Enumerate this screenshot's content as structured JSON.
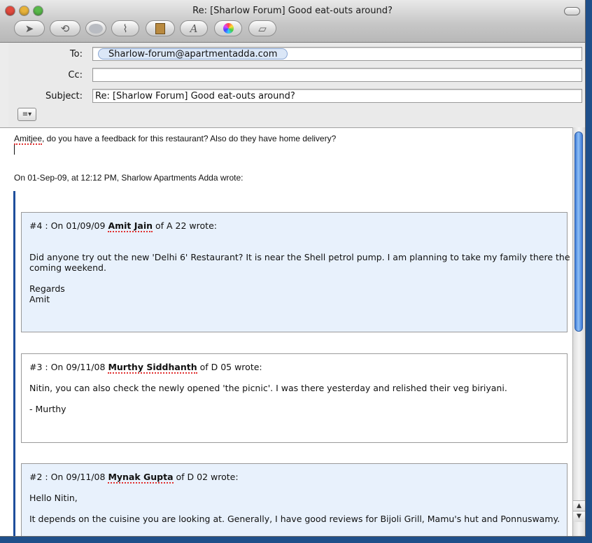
{
  "window": {
    "title": "Re: [Sharlow Forum] Good eat-outs around?",
    "traffic_colors": {
      "close": "#e24a3e",
      "minimize": "#e8b33a",
      "zoom": "#59b94a"
    }
  },
  "toolbar": {
    "buttons": [
      {
        "name": "send-icon",
        "glyph": "➤"
      },
      {
        "name": "reply-all-icon",
        "glyph": "⟲"
      },
      {
        "name": "chat-icon",
        "glyph": ""
      },
      {
        "name": "attach-icon",
        "glyph": "⌇"
      },
      {
        "name": "address-book-icon",
        "glyph": "▤"
      },
      {
        "name": "fonts-icon",
        "glyph": "A"
      },
      {
        "name": "colors-icon",
        "glyph": ""
      },
      {
        "name": "stationery-icon",
        "glyph": "▱"
      }
    ]
  },
  "header": {
    "to_label": "To:",
    "to_value": "Sharlow-forum@apartmentadda.com",
    "cc_label": "Cc:",
    "cc_value": "",
    "subject_label": "Subject:",
    "subject_value": "Re: [Sharlow Forum] Good eat-outs around?",
    "account_glyph": "≡▾"
  },
  "body": {
    "reply_prefix": "Amitjee",
    "reply_rest": ", do you have a feedback for this restaurant? Also do they have home delivery?",
    "attribution": "On 01-Sep-09, at 12:12 PM, Sharlow Apartments Adda wrote:"
  },
  "posts": [
    {
      "num": "#4 : On 01/09/09 ",
      "author": "Amit Jain",
      "suffix": " of A 22 wrote:",
      "lines": [
        "Did anyone try out the new 'Delhi 6' Restaurant? It is near the Shell petrol pump. I am planning to take my family there the",
        "coming weekend.",
        "Regards",
        "Amit"
      ]
    },
    {
      "num": "#3 : On 09/11/08 ",
      "author": "Murthy Siddhanth",
      "suffix": " of D 05 wrote:",
      "lines": [
        "Nitin, you can also check the newly opened 'the picnic'. I was there yesterday and relished their veg biriyani.",
        "- Murthy"
      ]
    },
    {
      "num": "#2 : On 09/11/08 ",
      "author": "Mynak Gupta",
      "suffix": " of D 02 wrote:",
      "lines": [
        "Hello Nitin,",
        "It depends on the cuisine you are looking at. Generally, I have good reviews for Bijoli Grill, Mamu's hut and Ponnuswamy."
      ]
    }
  ],
  "scrollbar": {
    "up_glyph": "▲",
    "down_glyph": "▼"
  },
  "colors": {
    "quote_bar": "#1f4f9c",
    "post_bg_blue": "#e8f1fc",
    "token_bg": "#dbe7f7"
  }
}
